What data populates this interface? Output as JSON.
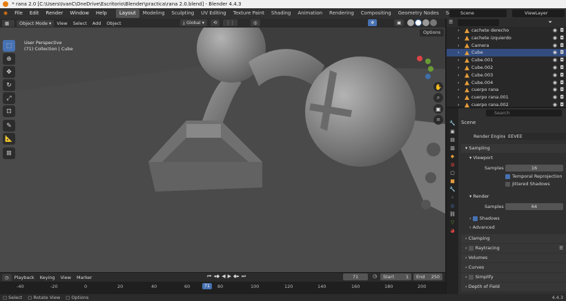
{
  "window": {
    "title": "* rana 2.0 [C:\\Users\\IvanC\\OneDrive\\Escritorio\\Blender\\practica\\rana 2.0.blend] - Blender 4.4.3"
  },
  "menu": {
    "items": [
      "File",
      "Edit",
      "Render",
      "Window",
      "Help"
    ]
  },
  "workspaces": {
    "tabs": [
      "Layout",
      "Modeling",
      "Sculpting",
      "UV Editing",
      "Texture Paint",
      "Shading",
      "Animation",
      "Rendering",
      "Compositing",
      "Geometry Nodes",
      "Scripting"
    ],
    "add": "+"
  },
  "scene": {
    "name": "Scene",
    "view_layer": "ViewLayer"
  },
  "viewport_header": {
    "mode": "Object Mode",
    "menus": [
      "View",
      "Select",
      "Add",
      "Object"
    ],
    "orientation": "Global",
    "options": "Options"
  },
  "viewport": {
    "view_name": "User Perspective",
    "collection": "(71) Collection | Cube"
  },
  "outliner": {
    "search_placeholder": "",
    "rows": [
      {
        "name": "cachete derecho",
        "selected": false
      },
      {
        "name": "cachete izquierdo",
        "selected": false
      },
      {
        "name": "Camera",
        "selected": false
      },
      {
        "name": "Cube",
        "selected": true
      },
      {
        "name": "Cube.001",
        "selected": false
      },
      {
        "name": "Cube.002",
        "selected": false
      },
      {
        "name": "Cube.003",
        "selected": false
      },
      {
        "name": "Cube.004",
        "selected": false
      },
      {
        "name": "cuerpo rana",
        "selected": false
      },
      {
        "name": "cuerpo rana.001",
        "selected": false
      },
      {
        "name": "cuerpo rana.002",
        "selected": false
      }
    ]
  },
  "properties": {
    "search_placeholder": "Search",
    "scene_label": "Scene",
    "render_engine_label": "Render Engine",
    "render_engine": "EEVEE",
    "sampling": "Sampling",
    "viewport": "Viewport",
    "samples_label": "Samples",
    "viewport_samples": "16",
    "temporal_reprojection": "Temporal Reprojection",
    "jittered_shadows": "Jittered Shadows",
    "render": "Render",
    "render_samples": "64",
    "shadows": "Shadows",
    "advanced": "Advanced",
    "clamping": "Clamping",
    "raytracing": "Raytracing",
    "volumes": "Volumes",
    "curves": "Curves",
    "simplify": "Simplify",
    "depth_of_field": "Depth of Field"
  },
  "timeline": {
    "menus": [
      "Playback",
      "Keying",
      "View",
      "Marker"
    ],
    "current_frame": "71",
    "start_label": "Start",
    "start": "1",
    "end_label": "End",
    "end": "250",
    "ticks": [
      "-40",
      "-20",
      "0",
      "20",
      "40",
      "60",
      "80",
      "100",
      "120",
      "140",
      "160",
      "180",
      "200"
    ]
  },
  "status": {
    "select": "Select",
    "rotate": "Rotate View",
    "options": "Options",
    "version": "4.4.3"
  },
  "colors": {
    "accent": "#4772b3",
    "viewport_bg": "#3d3d3d",
    "object_orange": "#e39c3b"
  }
}
